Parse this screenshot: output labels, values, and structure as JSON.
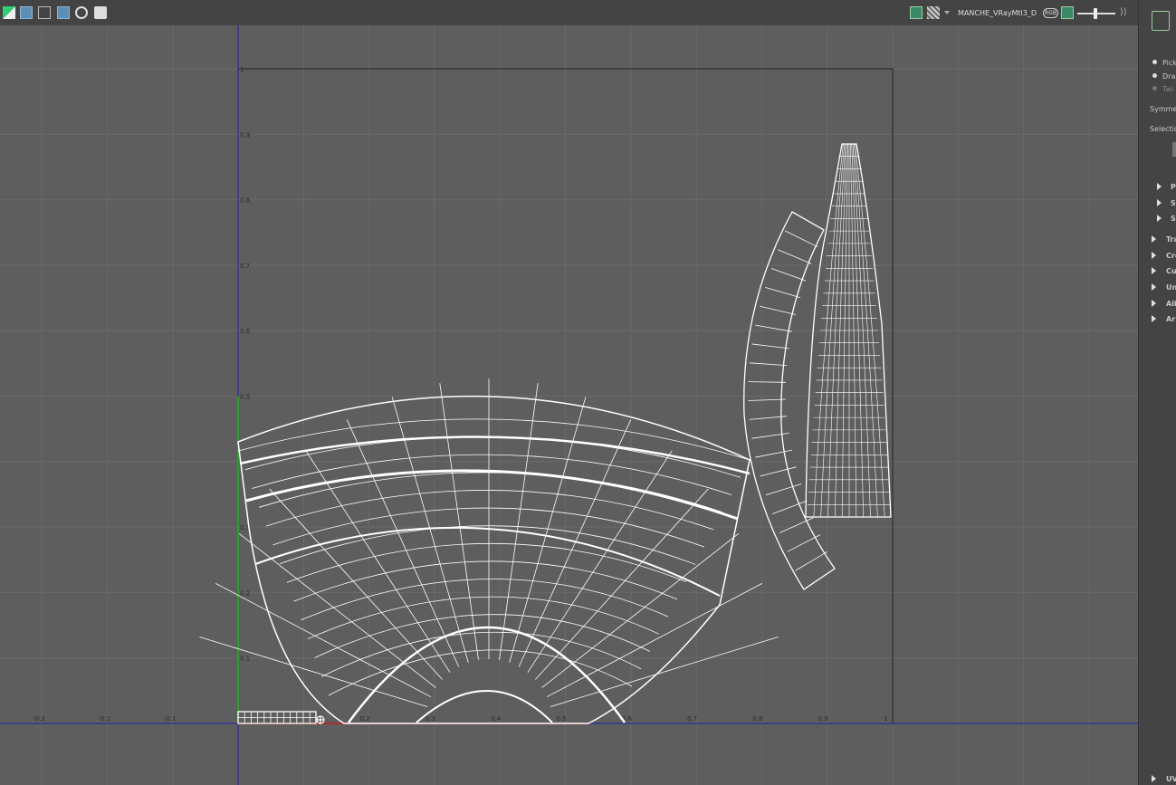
{
  "toolbar": {
    "material_name": "MANCHE_VRayMtl3_D",
    "rgb_badge": "RGB"
  },
  "uv_editor": {
    "axis_labels_x": [
      "-0.3",
      "-0.2",
      "-0.1",
      "0.2",
      "0.3",
      "0.4",
      "0.5",
      "0.6",
      "0.7",
      "0.8",
      "0.9",
      "1"
    ],
    "axis_labels_y": [
      "1",
      "0.9",
      "0.8",
      "0.7",
      "0.6",
      "0.5",
      "0.3",
      "0.2",
      "0.1"
    ]
  },
  "side_panel": {
    "radios": [
      {
        "label": "Pick",
        "enabled": true
      },
      {
        "label": "Dra",
        "enabled": true
      },
      {
        "label": "Twi",
        "enabled": false
      }
    ],
    "symmetry_label": "Symme",
    "selection_label": "Selectio",
    "collapsed_sections": [
      "Pi",
      "Se",
      "Se",
      "Tra",
      "Cre",
      "Cu",
      "Un",
      "Ali",
      "Ar"
    ],
    "bottom_section": "UV"
  }
}
